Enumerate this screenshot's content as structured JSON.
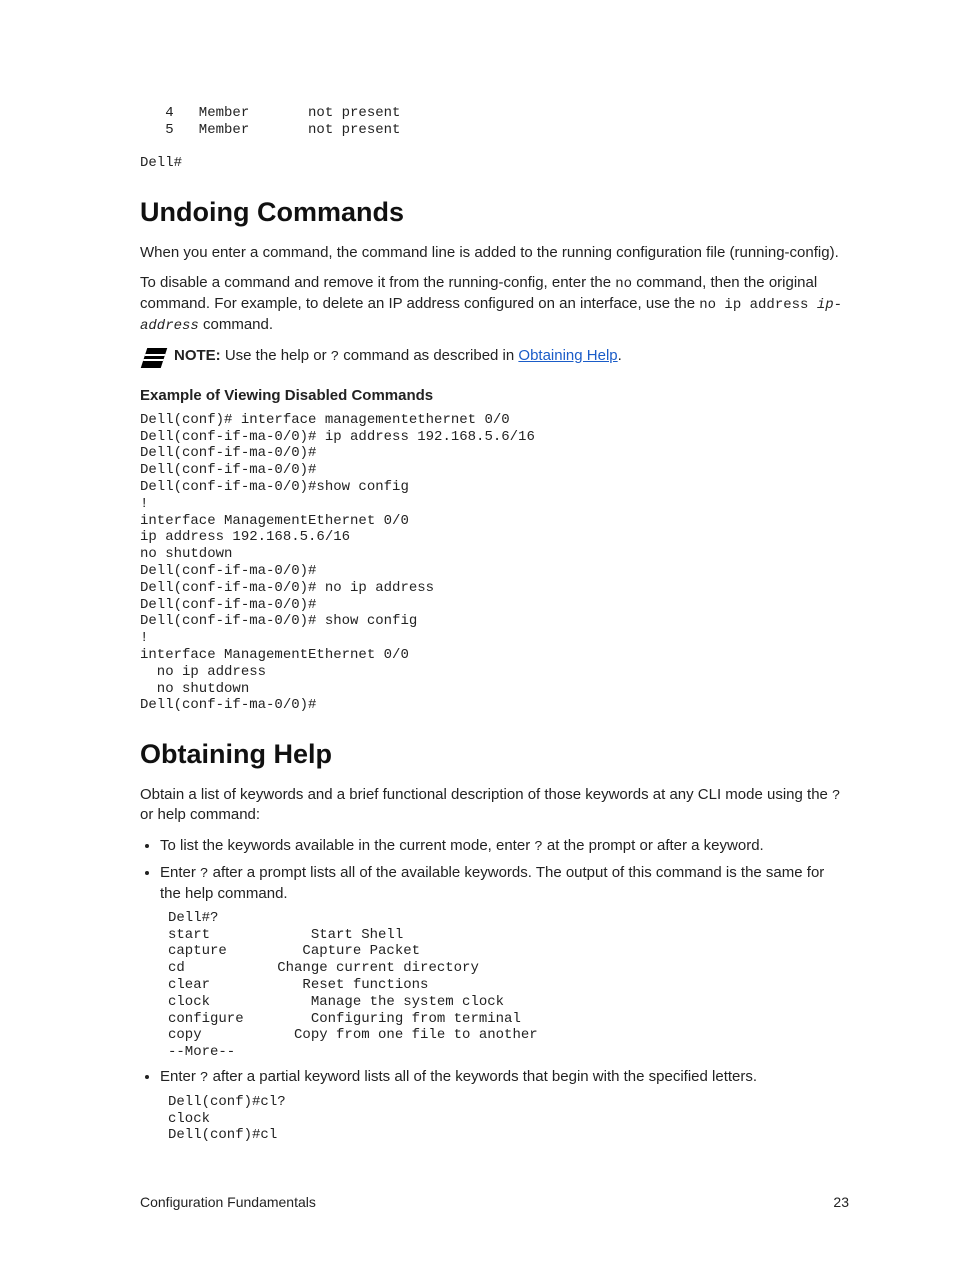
{
  "pre_top": "   4   Member       not present\n   5   Member       not present\n\nDell#",
  "h_undo": "Undoing Commands",
  "p_undo1": "When you enter a command, the command line is added to the running configuration file (running-config).",
  "p_undo2_a": "To disable a command and remove it from the running-config, enter the ",
  "p_undo2_no": "no",
  "p_undo2_b": " command, then the original command. For example, to delete an IP address configured on an interface, use the ",
  "p_undo2_cmd": "no ip address ",
  "p_undo2_arg": "ip-address",
  "p_undo2_c": " command.",
  "note_label": "NOTE:",
  "note_a": " Use the help or ",
  "note_q": "?",
  "note_b": " command as described in ",
  "note_link": "Obtaining Help",
  "note_c": ".",
  "subhead1": "Example of Viewing Disabled Commands",
  "pre_example": "Dell(conf)# interface managementethernet 0/0\nDell(conf-if-ma-0/0)# ip address 192.168.5.6/16\nDell(conf-if-ma-0/0)#\nDell(conf-if-ma-0/0)#\nDell(conf-if-ma-0/0)#show config\n!\ninterface ManagementEthernet 0/0\nip address 192.168.5.6/16\nno shutdown\nDell(conf-if-ma-0/0)#\nDell(conf-if-ma-0/0)# no ip address\nDell(conf-if-ma-0/0)#\nDell(conf-if-ma-0/0)# show config\n!\ninterface ManagementEthernet 0/0\n  no ip address\n  no shutdown\nDell(conf-if-ma-0/0)#",
  "h_help": "Obtaining Help",
  "p_help1_a": "Obtain a list of keywords and a brief functional description of those keywords at any CLI mode using the ",
  "p_help1_q": "?",
  "p_help1_b": " or help command:",
  "li1_a": "To list the keywords available in the current mode, enter ",
  "li1_q": "?",
  "li1_b": " at the prompt or after a keyword.",
  "li2_a": "Enter ",
  "li2_q": "?",
  "li2_b": " after a prompt lists all of the available keywords. The output of this command is the same for the help command.",
  "pre_help1": "Dell#?\nstart            Start Shell\ncapture         Capture Packet\ncd           Change current directory\nclear           Reset functions\nclock            Manage the system clock\nconfigure        Configuring from terminal\ncopy           Copy from one file to another\n--More--",
  "li3_a": "Enter ",
  "li3_q": "?",
  "li3_b": " after a partial keyword lists all of the keywords that begin with the specified letters.",
  "pre_help2": "Dell(conf)#cl?\nclock\nDell(conf)#cl",
  "footer_left": "Configuration Fundamentals",
  "footer_right": "23"
}
